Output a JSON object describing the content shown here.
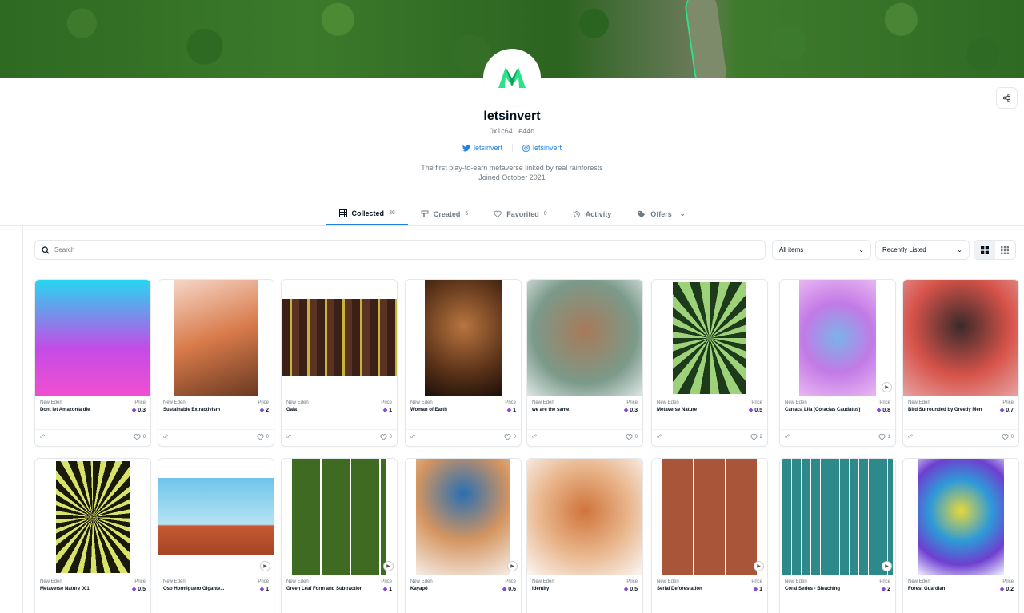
{
  "profile": {
    "name": "letsinvert",
    "wallet": "0x1c64...e44d",
    "twitter": "letsinvert",
    "instagram": "letsinvert",
    "bio": "The first play-to-earn metaverse linked by real rainforests",
    "joined": "Joined October 2021"
  },
  "tabs": [
    {
      "label": "Collected",
      "count": "36",
      "icon": "grid-icon"
    },
    {
      "label": "Created",
      "count": "5",
      "icon": "brush-icon"
    },
    {
      "label": "Favorited",
      "count": "0",
      "icon": "heart-icon"
    },
    {
      "label": "Activity",
      "icon": "history-icon"
    },
    {
      "label": "Offers",
      "icon": "tag-icon"
    }
  ],
  "filters": {
    "search_placeholder": "Search",
    "items_select": "All items",
    "sort_select": "Recently Listed"
  },
  "cards": [
    {
      "collection": "New Eden",
      "title": "Dont let Amazonia die",
      "price_label": "Price",
      "price": "0.3",
      "likes": "0"
    },
    {
      "collection": "New Eden",
      "title": "Sustainable Extractivism",
      "price_label": "Price",
      "price": "2",
      "likes": "0"
    },
    {
      "collection": "New Eden",
      "title": "Gaia",
      "price_label": "Price",
      "price": "1",
      "likes": "0"
    },
    {
      "collection": "New Eden",
      "title": "Woman of Earth",
      "price_label": "Price",
      "price": "1",
      "likes": "0"
    },
    {
      "collection": "New Eden",
      "title": "we are the same.",
      "price_label": "Price",
      "price": "0.3",
      "likes": "0"
    },
    {
      "collection": "New Eden",
      "title": "Metaverse Nature",
      "price_label": "Price",
      "price": "0.5",
      "likes": "2"
    },
    {
      "collection": "New Eden",
      "title": "Carraca Lila (Coracias Caudatus)",
      "price_label": "Price",
      "price": "0.8",
      "likes": "1"
    },
    {
      "collection": "New Eden",
      "title": "Bird Surrounded by Greedy Men",
      "price_label": "Price",
      "price": "0.7",
      "likes": "0"
    },
    {
      "collection": "New Eden",
      "title": "Metaverse Nature 001",
      "price_label": "Price",
      "price": "0.5"
    },
    {
      "collection": "New Eden",
      "title": "Oso Hormiguero Gigante...",
      "price_label": "Price",
      "price": "1"
    },
    {
      "collection": "New Eden",
      "title": "Green Leaf Form and Subtraction",
      "price_label": "Price",
      "price": "1"
    },
    {
      "collection": "New Eden",
      "title": "Kayapó",
      "price_label": "Price",
      "price": "0.6"
    },
    {
      "collection": "New Eden",
      "title": "Identity",
      "price_label": "Price",
      "price": "0.5"
    },
    {
      "collection": "New Eden",
      "title": "Serial Deforestation",
      "price_label": "Price",
      "price": "1"
    },
    {
      "collection": "New Eden",
      "title": "Coral Series - Bleaching",
      "price_label": "Price",
      "price": "2"
    },
    {
      "collection": "New Eden",
      "title": "Forest Guardian",
      "price_label": "Price",
      "price": "0.2"
    }
  ],
  "colors": {
    "accent": "#2081e2",
    "eth": "#8247e5",
    "logo_green": "#2de089"
  }
}
